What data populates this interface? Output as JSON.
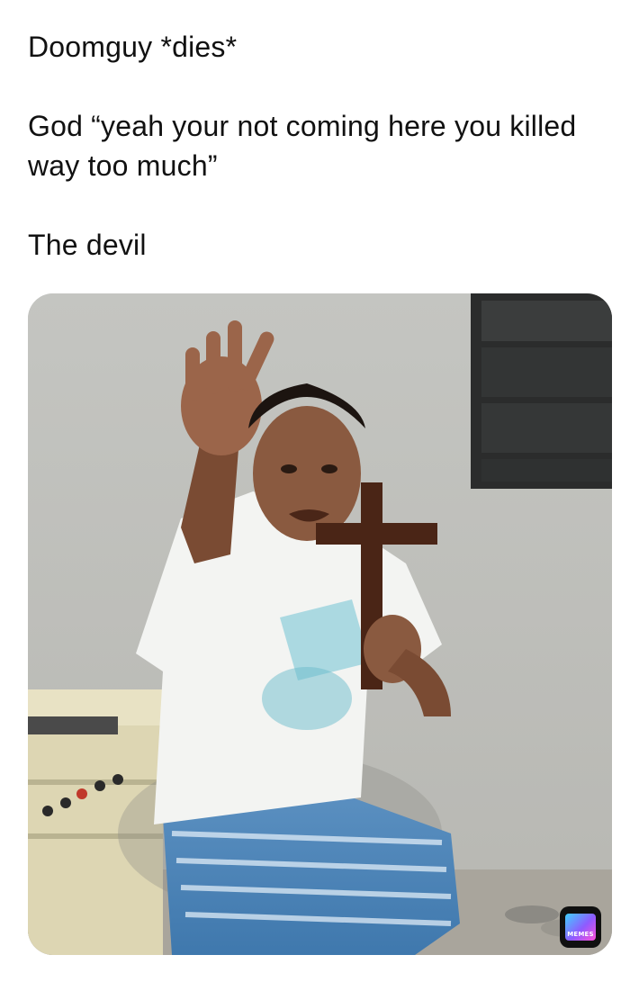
{
  "caption": {
    "line1": "Doomguy *dies*",
    "line2": "God “yeah your not coming here you killed way too much”",
    "line3": "The devil"
  },
  "photo": {
    "description_icon": "meme-photo"
  },
  "badge": {
    "label": "MEMES",
    "icon": "memes-app-icon"
  },
  "colors": {
    "background": "#ffffff",
    "text": "#111111",
    "badge": "#101010"
  }
}
